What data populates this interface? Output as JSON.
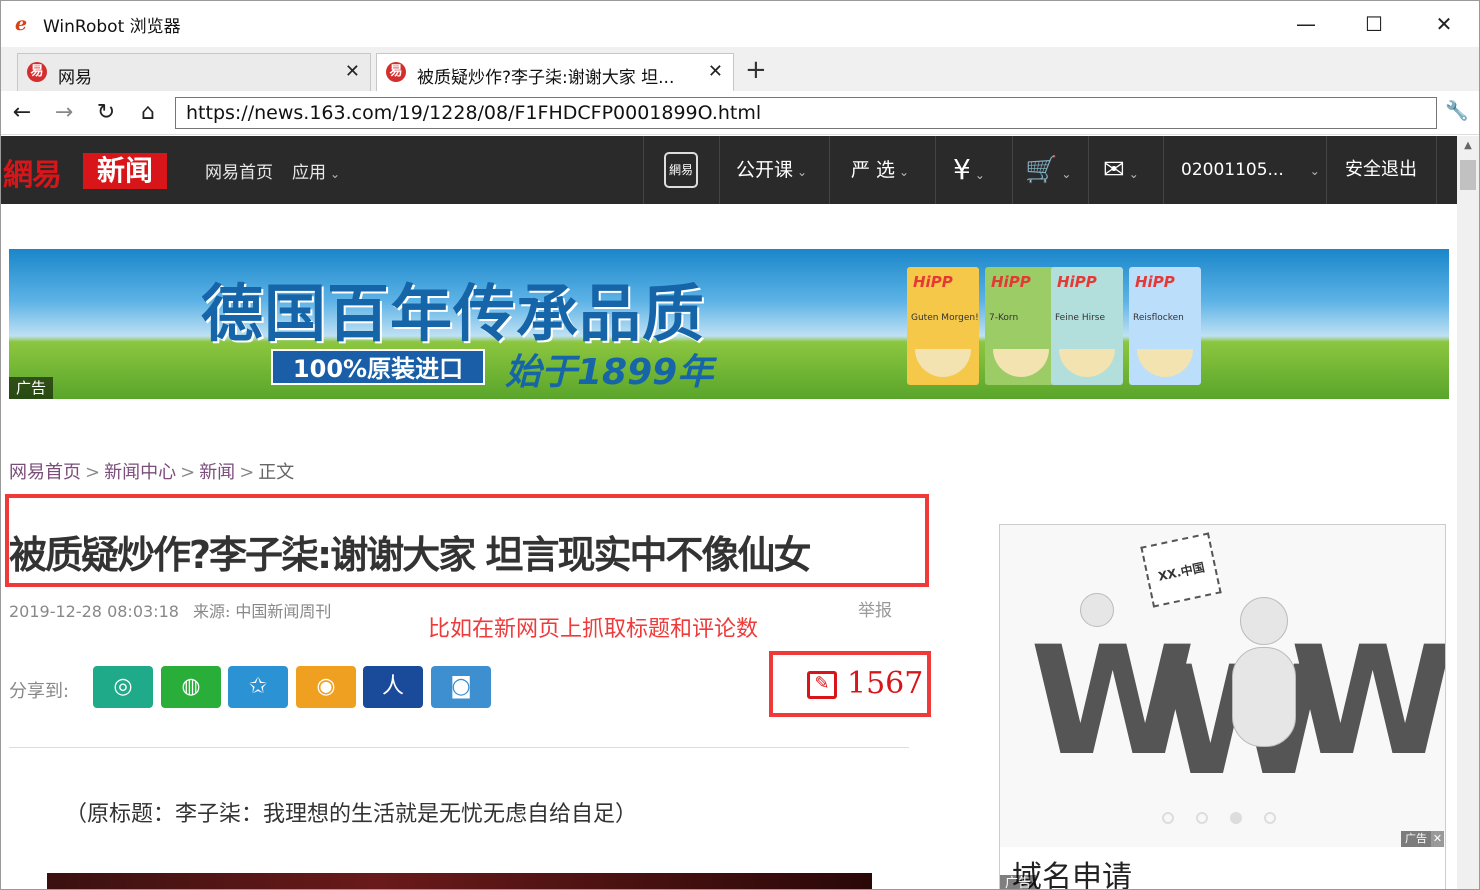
{
  "window": {
    "title": "WinRobot 浏览器",
    "app_icon": "e"
  },
  "tabs": [
    {
      "label": "网易",
      "active": false
    },
    {
      "label": "被质疑炒作?李子柒:谢谢大家 坦...",
      "active": true
    }
  ],
  "address": {
    "url": "https://news.163.com/19/1228/08/F1FHDCFP0001899O.html"
  },
  "site_nav": {
    "logo_text": "網易",
    "logo_news": "新闻",
    "home": "网易首页",
    "apps": "应用",
    "phone_label": "網易",
    "open_course": "公开课",
    "yanxuan": "严 选",
    "account": "02001105...",
    "logout": "安全退出"
  },
  "banner": {
    "headline": "德国百年传承品质",
    "badge": "100%原装进口",
    "sub": "始于1899年",
    "ad_tag": "广告",
    "products": [
      {
        "brand": "HiPP",
        "name": "Guten Morgen!",
        "color": "#f5c84a"
      },
      {
        "brand": "HiPP",
        "name": "7-Korn",
        "color": "#9ccc65"
      },
      {
        "brand": "HiPP",
        "name": "Feine Hirse",
        "color": "#b2dfdb"
      },
      {
        "brand": "HiPP",
        "name": "Reisflocken",
        "color": "#bbdefb"
      }
    ]
  },
  "breadcrumb": {
    "home": "网易首页",
    "center": "新闻中心",
    "news": "新闻",
    "current": "正文",
    "sep": ">"
  },
  "article": {
    "title": "被质疑炒作?李子柒:谢谢大家 坦言现实中不像仙女",
    "date": "2019-12-28 08:03:18",
    "source": "来源: 中国新闻周刊",
    "report": "举报",
    "annotation": "比如在新网页上抓取标题和评论数",
    "share_label": "分享到:",
    "comment_count": "1567",
    "lead": "（原标题：李子柒：我理想的生活就是无忧无虑自给自足）"
  },
  "share_buttons": [
    {
      "name": "qq",
      "color": "#1fab89"
    },
    {
      "name": "wechat",
      "color": "#2aae3a"
    },
    {
      "name": "qzone",
      "color": "#2b92d4"
    },
    {
      "name": "weibo",
      "color": "#f0a020"
    },
    {
      "name": "renren",
      "color": "#1a4a9a"
    },
    {
      "name": "yixin",
      "color": "#3d8fd0"
    }
  ],
  "side_ad": {
    "sign": "XX.中国",
    "title": "域名申请",
    "ad_tag": "广告",
    "mini_tag": "广告"
  },
  "colors": {
    "accent_red": "#ef3a3a",
    "netease_red": "#d8161a",
    "nav_dark": "#2a2a2a"
  }
}
